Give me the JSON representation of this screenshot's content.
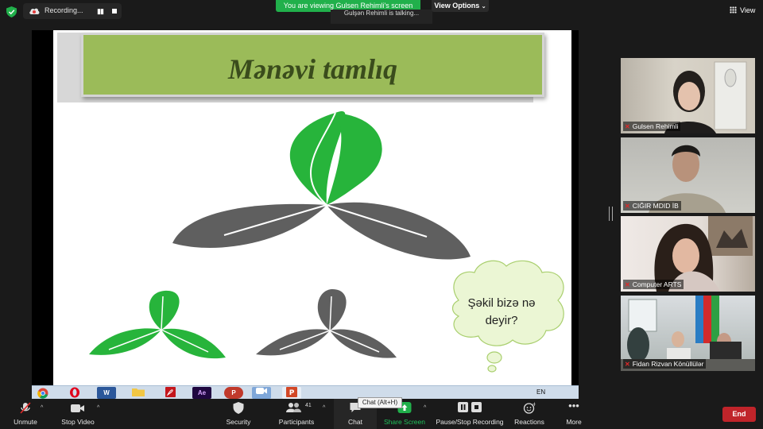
{
  "top_bar": {
    "recording_label": "Recording...",
    "viewing_banner": "You are viewing Gulsen Rehimli's screen",
    "talking_label": "Gulşən Rehimli is talking...",
    "view_options_label": "View Options",
    "view_label": "View"
  },
  "slide": {
    "title": "Mənəvi tamlıq",
    "bubble_line1": "Şəkil bizə nə",
    "bubble_line2": "deyir?"
  },
  "taskbar": {
    "icons": [
      "chrome-icon",
      "opera-icon",
      "W",
      "folder-icon",
      "pdf-icon",
      "Ae",
      "P",
      "zoom-icon",
      "powerpoint-icon"
    ],
    "language": "EN"
  },
  "participants": [
    {
      "name": "Gulsen Rehimli",
      "muted": true
    },
    {
      "name": "CIĞIR MDID İB",
      "muted": true
    },
    {
      "name": "Computer ARTS",
      "muted": true
    },
    {
      "name": "Fidan Rizvan Könüllülər",
      "muted": true
    }
  ],
  "toolbar": {
    "unmute": "Unmute",
    "stop_video": "Stop Video",
    "security": "Security",
    "participants": "Participants",
    "participants_count": "41",
    "chat": "Chat",
    "chat_tooltip": "Chat (Alt+H)",
    "share_screen": "Share Screen",
    "pause_recording": "Pause/Stop Recording",
    "reactions": "Reactions",
    "more": "More",
    "end": "End"
  },
  "colors": {
    "banner_green": "#21b04b",
    "slide_title_bg": "#9bbb59",
    "leaf_green": "#27b43b",
    "leaf_grey": "#5f5f5f",
    "bubble_fill": "#ebf6d4",
    "end_red": "#c0242a"
  }
}
